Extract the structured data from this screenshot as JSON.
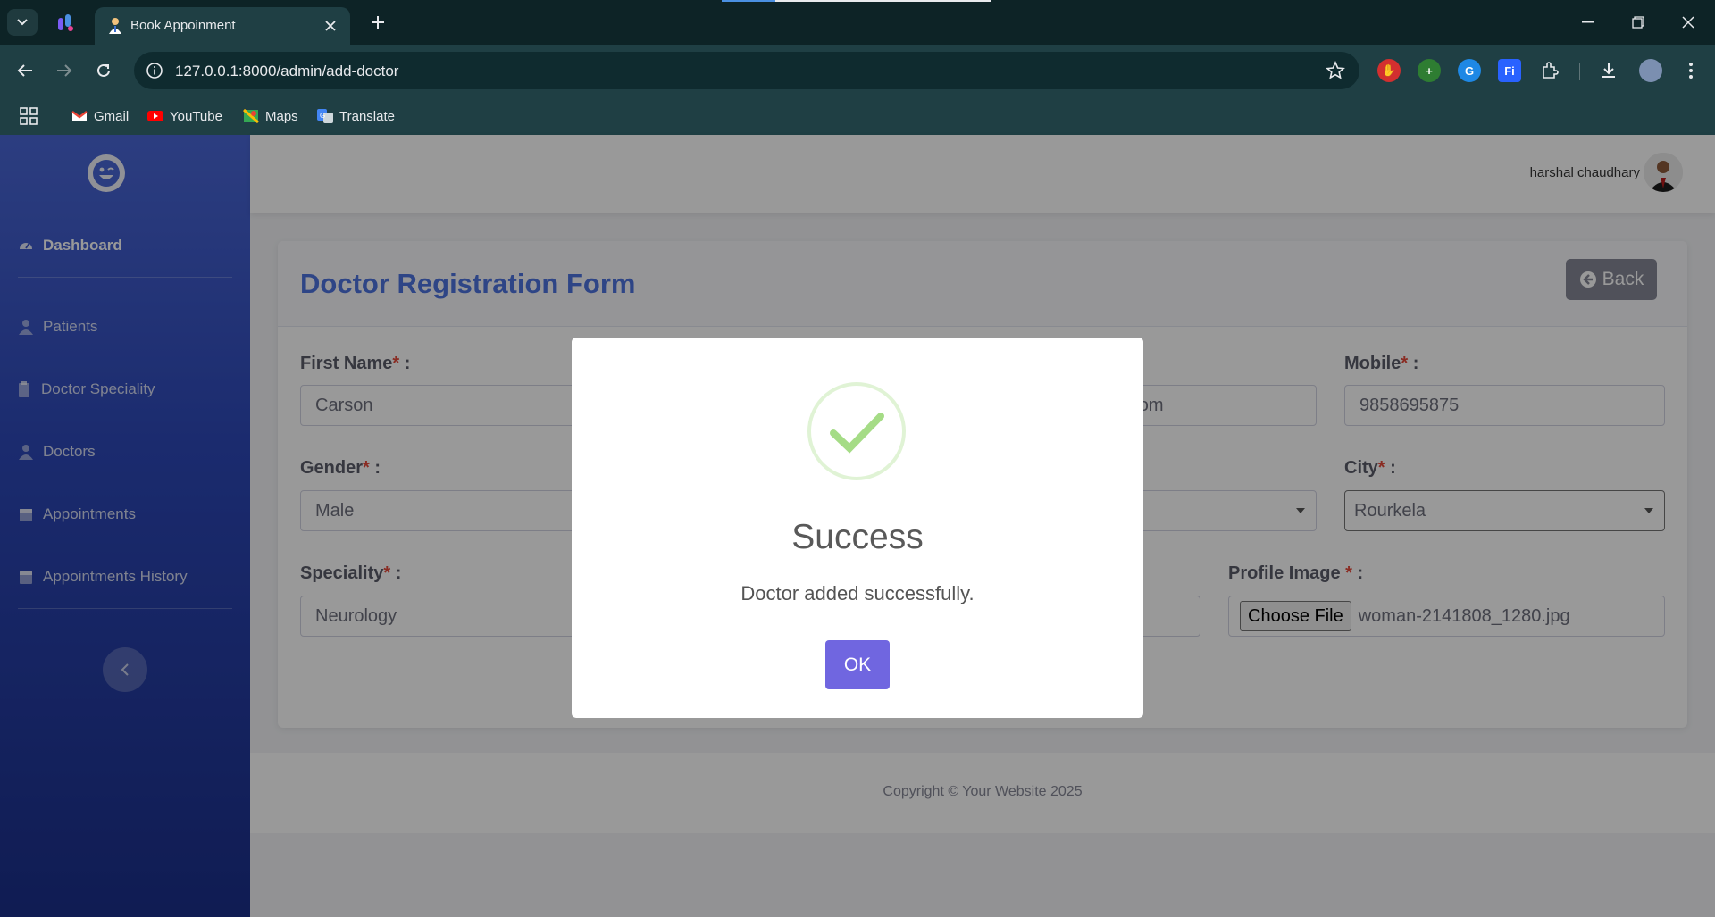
{
  "browser": {
    "tab_title": "Book Appoinment",
    "url": "127.0.0.1:8000/admin/add-doctor",
    "bookmarks": [
      "Gmail",
      "YouTube",
      "Maps",
      "Translate"
    ]
  },
  "sidebar": {
    "items": [
      {
        "label": "Dashboard",
        "icon": "dashboard-icon"
      },
      {
        "label": "Patients",
        "icon": "user-icon"
      },
      {
        "label": "Doctor Speciality",
        "icon": "clipboard-icon"
      },
      {
        "label": "Doctors",
        "icon": "user-icon"
      },
      {
        "label": "Appointments",
        "icon": "calendar-icon"
      },
      {
        "label": "Appointments History",
        "icon": "calendar-icon"
      }
    ]
  },
  "topbar": {
    "user_name": "harshal chaudhary"
  },
  "form": {
    "title": "Doctor Registration Form",
    "back_label": "Back",
    "first_name_label": "First Name",
    "first_name_value": "Carson",
    "email_value_visible": "nail.com",
    "mobile_label": "Mobile",
    "mobile_value": "9858695875",
    "gender_label": "Gender",
    "gender_value": "Male",
    "city_label": "City",
    "city_value": "Rourkela",
    "speciality_label": "Speciality",
    "speciality_value": "Neurology",
    "profile_image_label": "Profile Image",
    "file_button_label": "Choose File",
    "file_name": "woman-2141808_1280.jpg"
  },
  "footer": {
    "text": "Copyright © Your Website 2025"
  },
  "modal": {
    "title": "Success",
    "message": "Doctor added successfully.",
    "ok_label": "OK",
    "accent_color": "#7066e0",
    "icon": "check-icon"
  }
}
